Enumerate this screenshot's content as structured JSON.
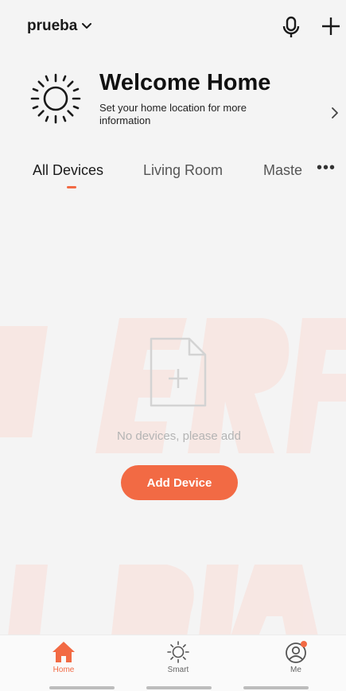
{
  "header": {
    "home_name": "prueba"
  },
  "welcome": {
    "title": "Welcome Home",
    "subtitle": "Set your home location for more information"
  },
  "tabs": [
    {
      "label": "All Devices",
      "active": true
    },
    {
      "label": "Living Room",
      "active": false
    },
    {
      "label": "Maste",
      "active": false
    }
  ],
  "tabs_more": "•••",
  "empty_state": {
    "message": "No devices, please add",
    "button_label": "Add Device"
  },
  "bottom_nav": [
    {
      "label": "Home",
      "icon": "home-icon",
      "active": true
    },
    {
      "label": "Smart",
      "icon": "sun-icon",
      "active": false
    },
    {
      "label": "Me",
      "icon": "profile-icon",
      "active": false,
      "notification": true
    }
  ],
  "colors": {
    "accent": "#f26a44",
    "background": "#f4f4f4",
    "muted_text": "#b4b4b4"
  }
}
